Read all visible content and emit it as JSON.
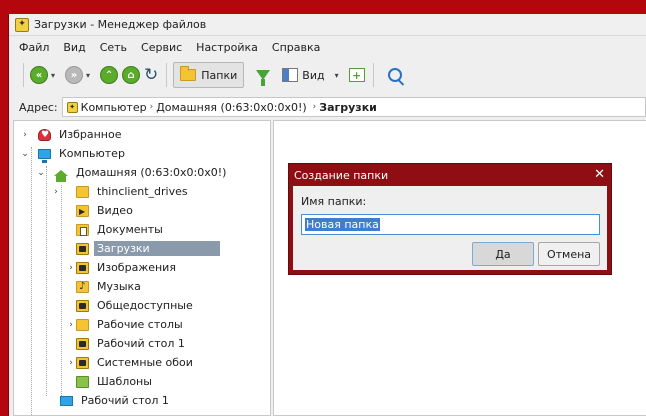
{
  "window": {
    "title": "Загрузки - Менеджер файлов"
  },
  "menu": [
    "Файл",
    "Вид",
    "Сеть",
    "Сервис",
    "Настройка",
    "Справка"
  ],
  "toolbar": {
    "folders_label": "Папки",
    "view_label": "Вид"
  },
  "address": {
    "label": "Адрес:",
    "crumbs": [
      "Компьютер",
      "Домашняя (0:63:0x0:0x0!)",
      "Загрузки"
    ]
  },
  "tree": {
    "items": [
      {
        "label": "Избранное"
      },
      {
        "label": "Компьютер"
      },
      {
        "label": "Домашняя (0:63:0x0:0x0!)"
      },
      {
        "label": "thinclient_drives"
      },
      {
        "label": "Видео"
      },
      {
        "label": "Документы"
      },
      {
        "label": "Загрузки"
      },
      {
        "label": "Изображения"
      },
      {
        "label": "Музыка"
      },
      {
        "label": "Общедоступные"
      },
      {
        "label": "Рабочие столы"
      },
      {
        "label": "Рабочий стол 1"
      },
      {
        "label": "Системные обои"
      },
      {
        "label": "Шаблоны"
      },
      {
        "label": "Рабочий стол 1"
      }
    ]
  },
  "dialog": {
    "title": "Создание папки",
    "field_label": "Имя папки:",
    "field_value": "Новая папка",
    "ok_label": "Да",
    "cancel_label": "Отмена"
  }
}
